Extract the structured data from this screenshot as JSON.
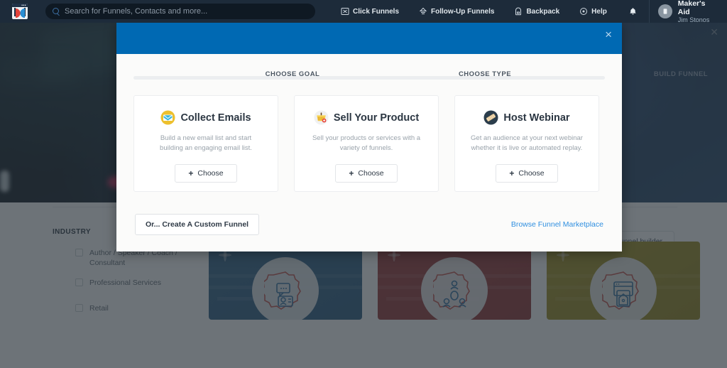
{
  "topnav": {
    "logo_icon": "clickfunnels-logo-icon",
    "search": {
      "icon": "search-icon",
      "placeholder": "Search for Funnels, Contacts and more...",
      "value": ""
    },
    "items": [
      {
        "label": "Click Funnels",
        "icon": "funnels-icon"
      },
      {
        "label": "Follow-Up Funnels",
        "icon": "followup-icon"
      },
      {
        "label": "Backpack",
        "icon": "backpack-icon"
      },
      {
        "label": "Help",
        "icon": "help-icon"
      }
    ],
    "notifications_icon": "bell-icon",
    "account": {
      "avatar_icon": "avatar-icon",
      "name": "Maker's Aid",
      "user": "Jim Stonos"
    }
  },
  "page": {
    "close_label": "✕",
    "filters": {
      "title": "INDUSTRY",
      "options": [
        {
          "label": "Author / Speaker / Coach / Consultant",
          "checked": false
        },
        {
          "label": "Professional Services",
          "checked": false
        },
        {
          "label": "Retail",
          "checked": false
        }
      ]
    },
    "classic_builder_label": "Classic funnel builder",
    "template_cards": [
      {
        "color": "#2e5f86",
        "icon": "chat-profile-badge-icon"
      },
      {
        "color": "#993434",
        "icon": "people-badge-icon"
      },
      {
        "color": "#a08f1e",
        "icon": "home-window-badge-icon"
      }
    ]
  },
  "modal": {
    "close_label": "×",
    "header_color": "#0069b3",
    "accent_color": "#10c56d",
    "steps": [
      {
        "label": "CHOOSE GOAL",
        "active": true
      },
      {
        "label": "CHOOSE TYPE",
        "active": false
      },
      {
        "label": "BUILD FUNNEL",
        "active": false
      }
    ],
    "cards": [
      {
        "icon": "envelope-icon",
        "title": "Collect Emails",
        "description": "Build a new email list and start building an engaging email list.",
        "button": "Choose",
        "button_plus": "+"
      },
      {
        "icon": "shopping-basket-icon",
        "title": "Sell Your Product",
        "description": "Sell your products or services with a variety of funnels.",
        "button": "Choose",
        "button_plus": "+"
      },
      {
        "icon": "ticket-icon",
        "title": "Host Webinar",
        "description": "Get an audience at your next webinar whether it is live or automated replay.",
        "button": "Choose",
        "button_plus": "+"
      }
    ],
    "footer": {
      "custom_funnel_label": "Or... Create A Custom Funnel",
      "marketplace_label": "Browse Funnel Marketplace"
    }
  }
}
